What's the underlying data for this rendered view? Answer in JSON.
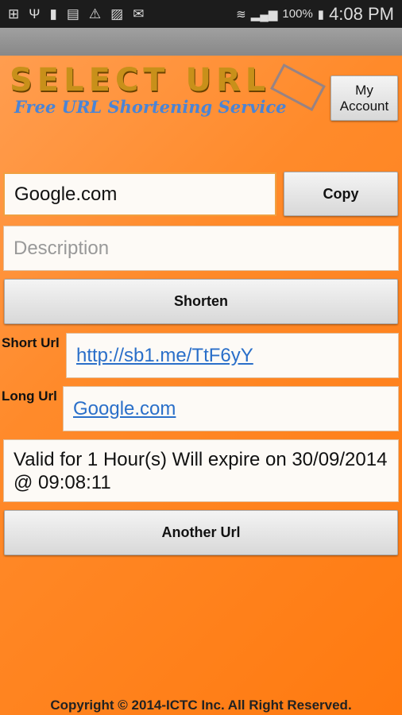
{
  "status_bar": {
    "icons": [
      "add-icon",
      "usb-icon",
      "battery-100-icon",
      "sim-icon",
      "warning-icon",
      "image-icon",
      "gmail-icon"
    ],
    "battery": "100%",
    "time": "4:08 PM"
  },
  "logo": {
    "title": "SELECT URL",
    "tagline": "Free URL Shortening Service"
  },
  "header": {
    "my_account": "My Account"
  },
  "form": {
    "url_value": "Google.com",
    "copy": "Copy",
    "description_placeholder": "Description",
    "shorten": "Shorten"
  },
  "result": {
    "short_label": "Short Url",
    "short_value": "http://sb1.me/TtF6yY",
    "long_label": "Long Url",
    "long_value": "Google.com",
    "validity": "Valid for 1 Hour(s) Will expire on 30/09/2014 @ 09:08:11",
    "another": "Another Url"
  },
  "footer": "Copyright © 2014-ICTC Inc. All Right Reserved."
}
